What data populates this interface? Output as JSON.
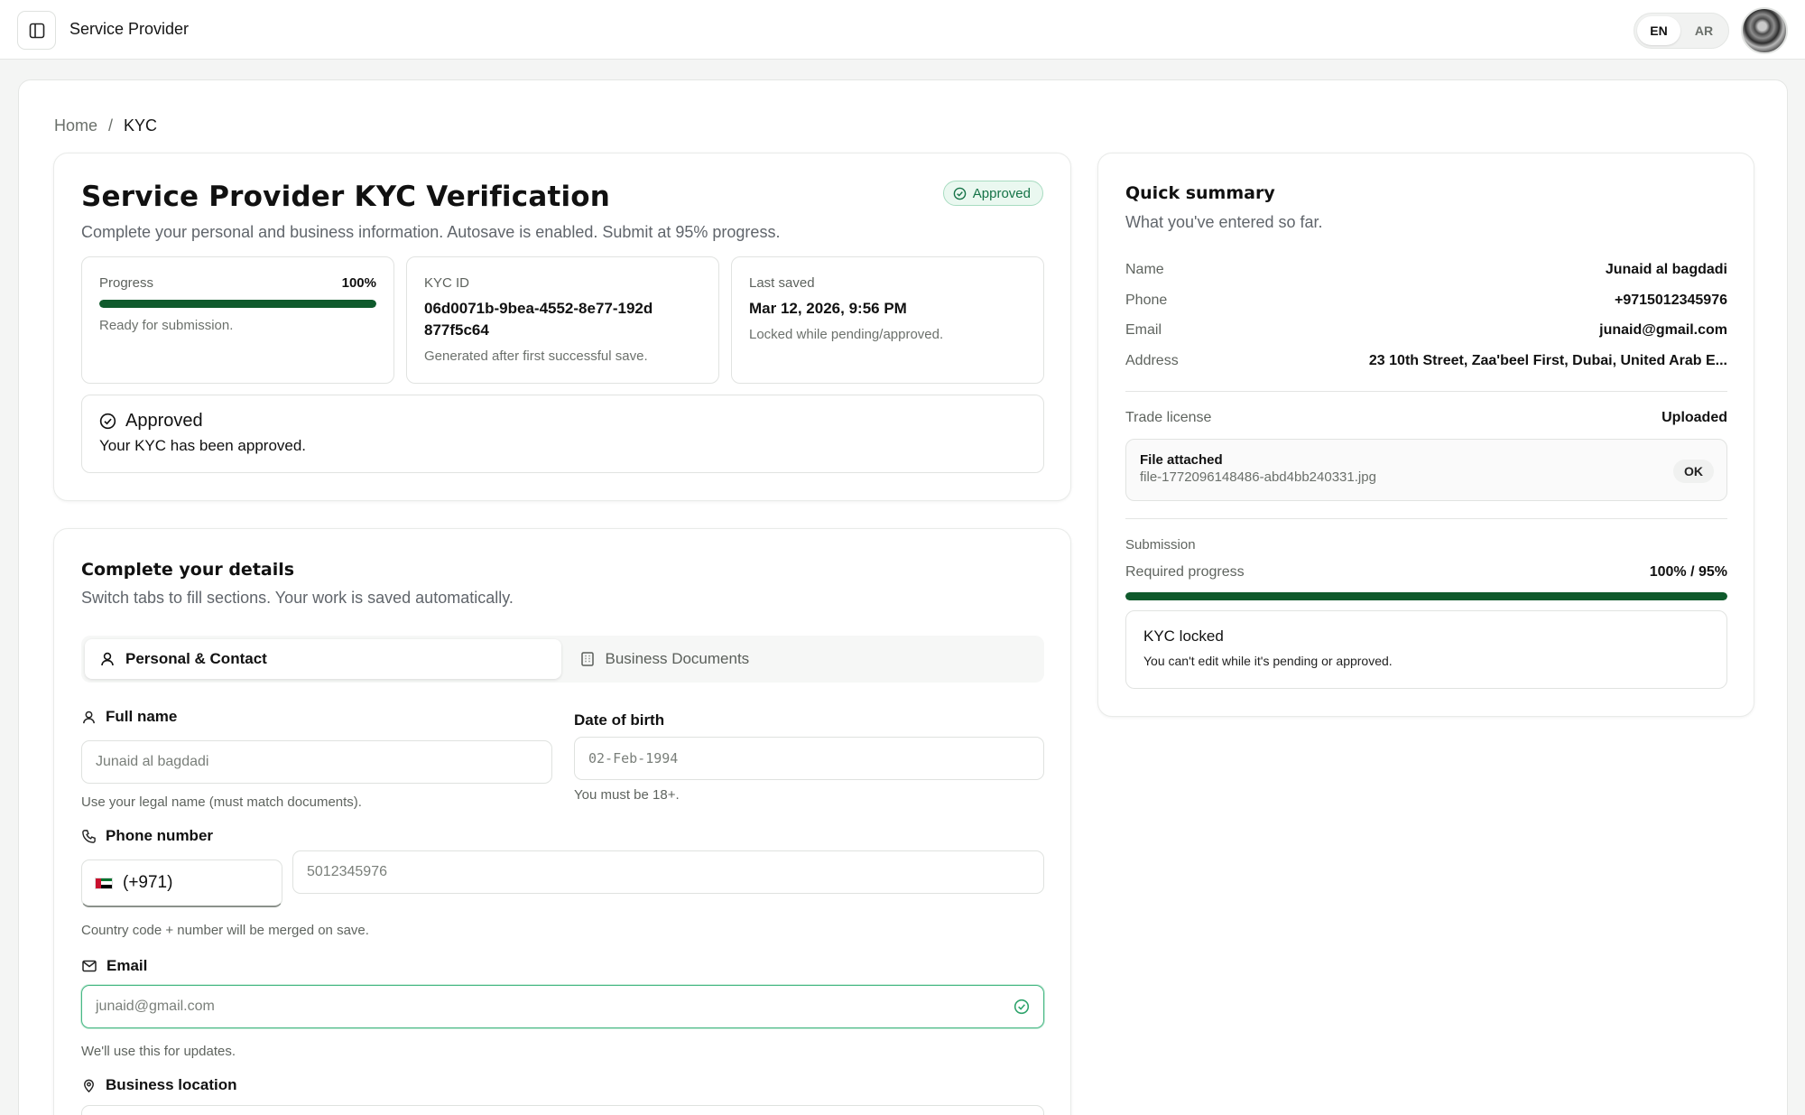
{
  "header": {
    "app_title": "Service Provider",
    "languages": [
      {
        "label": "EN",
        "active": true
      },
      {
        "label": "AR",
        "active": false
      }
    ]
  },
  "breadcrumb": {
    "home": "Home",
    "separator": "/",
    "current": "KYC"
  },
  "kyc": {
    "title": "Service Provider KYC Verification",
    "status": "Approved",
    "subtitle": "Complete your personal and business information. Autosave is enabled. Submit at 95% progress.",
    "progress": {
      "label": "Progress",
      "value_text": "100%",
      "value": 1.0,
      "note": "Ready for submission."
    },
    "kyc_id": {
      "label": "KYC ID",
      "value": "06d0071b-9bea-4552-8e77-192d877f5c64",
      "note": "Generated after first successful save."
    },
    "last_saved": {
      "label": "Last saved",
      "value": "Mar 12, 2026, 9:56 PM",
      "note": "Locked while pending/approved."
    },
    "approved_box": {
      "title": "Approved",
      "message": "Your KYC has been approved."
    }
  },
  "details": {
    "title": "Complete your details",
    "subtitle": "Switch tabs to fill sections. Your work is saved automatically.",
    "tabs": [
      {
        "label": "Personal & Contact",
        "active": true
      },
      {
        "label": "Business Documents",
        "active": false
      }
    ],
    "full_name": {
      "label": "Full name",
      "value": "Junaid al bagdadi",
      "hint": "Use your legal name (must match documents)."
    },
    "dob": {
      "label": "Date of birth",
      "value": "02-Feb-1994",
      "hint": "You must be 18+."
    },
    "phone": {
      "label": "Phone number",
      "code": "(+971)",
      "value": "5012345976",
      "hint": "Country code + number will be merged on save."
    },
    "email": {
      "label": "Email",
      "value": "junaid@gmail.com",
      "hint": "We'll use this for updates."
    },
    "location": {
      "label": "Business location"
    }
  },
  "summary": {
    "title": "Quick summary",
    "subtitle": "What you've entered so far.",
    "rows": [
      {
        "key": "Name",
        "value": "Junaid al bagdadi"
      },
      {
        "key": "Phone",
        "value": "+9715012345976"
      },
      {
        "key": "Email",
        "value": "junaid@gmail.com"
      },
      {
        "key": "Address",
        "value": "23 10th Street, Zaa'beel First, Dubai, United Arab E..."
      }
    ],
    "trade_license": {
      "key": "Trade license",
      "value": "Uploaded"
    },
    "file": {
      "title": "File attached",
      "name": "file-1772096148486-abd4bb240331.jpg",
      "status": "OK"
    },
    "submission": {
      "label": "Submission",
      "required_label": "Required progress",
      "required_value": "100% / 95%",
      "progress": 1.0
    },
    "locked": {
      "title": "KYC locked",
      "message": "You can't edit while it's pending or approved."
    }
  },
  "colors": {
    "accent_green": "#0f5a2c",
    "badge_green": "#157347",
    "email_valid": "#49b886"
  }
}
